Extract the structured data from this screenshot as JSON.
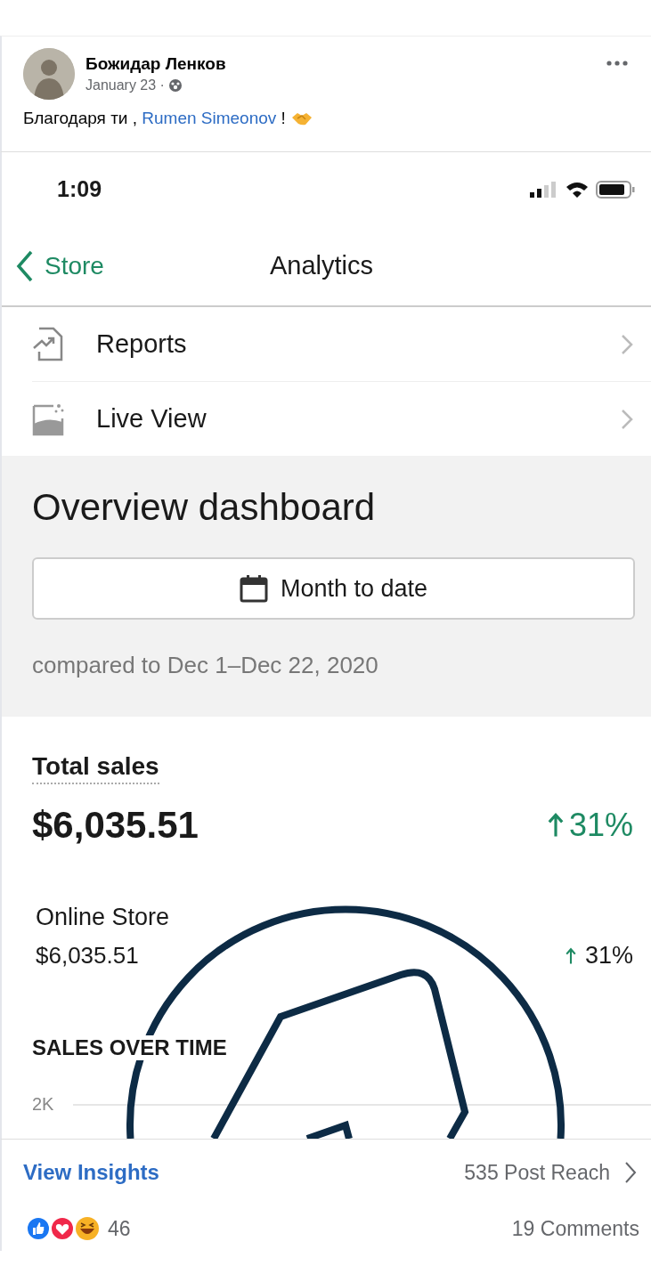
{
  "post": {
    "author": "Божидар Ленков",
    "date": "January 23 ·",
    "caption": {
      "text_before": "Благодаря ти , ",
      "mention": "Rumen Simeonov",
      "text_after": " !"
    }
  },
  "screenshot": {
    "status_bar": {
      "time": "1:09"
    },
    "nav": {
      "back_label": "Store",
      "title": "Analytics"
    },
    "menu_items": [
      {
        "kind": "reports",
        "label": "Reports"
      },
      {
        "kind": "live_view",
        "label": "Live View"
      }
    ],
    "overview": {
      "title": "Overview dashboard",
      "date_range_button": "Month to date",
      "comparison": "compared to Dec 1–Dec 22, 2020"
    },
    "total_sales": {
      "label": "Total sales",
      "value": "$6,035.51",
      "change": "31%"
    },
    "channels": [
      {
        "name": "Online Store",
        "value": "$6,035.51",
        "change": "31%"
      }
    ],
    "sales_over_time": {
      "title": "SALES OVER TIME",
      "y_tick": "2K"
    }
  },
  "footer": {
    "view_insights": "View Insights",
    "post_reach": "535 Post Reach",
    "reactions_count": "46",
    "comments": "19 Comments"
  }
}
